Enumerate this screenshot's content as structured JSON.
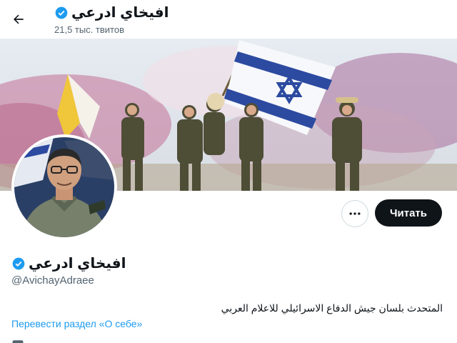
{
  "header": {
    "name": "افيخاي ادرعي",
    "tweet_count": "21,5 тыс. твитов"
  },
  "profile": {
    "name": "افيخاي ادرعي",
    "handle": "@AvichayAdraee",
    "bio": "المتحدث بلسان جيش الدفاع الاسرائيلي للاعلام العربي",
    "translate_label": "Перевести раздел «О себе»"
  },
  "actions": {
    "follow_label": "Читать"
  },
  "icons": {
    "back": "arrow-left-icon",
    "verified": "verified-badge-icon",
    "more": "more-horizontal-icon"
  },
  "colors": {
    "accent": "#1d9bf0",
    "follow_bg": "#0f1419",
    "secondary_text": "#536471"
  }
}
